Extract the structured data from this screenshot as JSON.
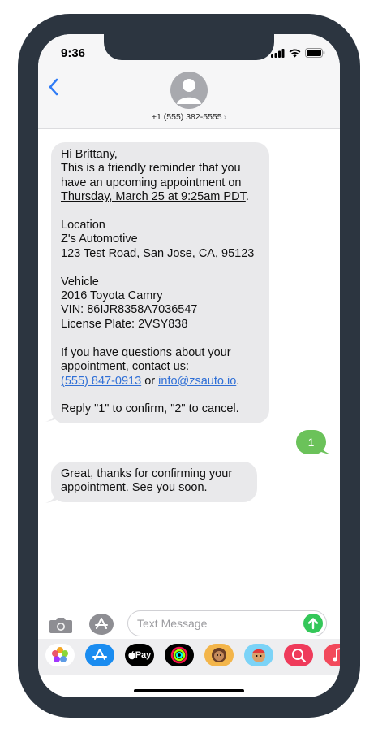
{
  "status": {
    "time": "9:36"
  },
  "contact": {
    "phone": "+1 (555) 382-5555",
    "chevron": "›"
  },
  "messages": {
    "m1": {
      "line1": "Hi Brittany,\nThis is a friendly reminder that you have an upcoming appointment on",
      "date": "Thursday, March 25 at 9:25am PDT",
      "line2": ".\n\nLocation\nZ's Automotive\n",
      "address": "123 Test Road, San Jose, CA, 95123",
      "line3": "\n\nVehicle\n2016 Toyota Camry\nVIN: 86IJR8358A7036547\nLicense Plate: 2VSY838\n\nIf you have questions about your appointment, contact us:\n",
      "phone": "(555) 847-0913",
      "or": " or ",
      "email": "info@zsauto.io",
      "line4": ".\n\nReply \"1\" to confirm, \"2\" to cancel."
    },
    "sent": "1",
    "m2": "Great, thanks for confirming your appointment. See you soon."
  },
  "composer": {
    "placeholder": "Text Message"
  },
  "dock": {
    "apple_pay_label": "Pay",
    "apps": [
      "photos-icon",
      "app-store-icon",
      "apple-pay-icon",
      "fitness-icon",
      "memoji-icon",
      "memoji-2-icon",
      "search-images-icon",
      "music-icon"
    ]
  },
  "colors": {
    "bubble_gray": "#e9e9eb",
    "bubble_green": "#6bc25a",
    "link_blue": "#2f6fd6",
    "frame": "#2c3540"
  }
}
